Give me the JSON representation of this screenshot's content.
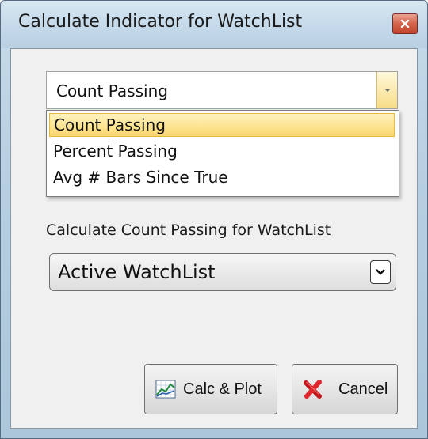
{
  "window": {
    "title": "Calculate Indicator for WatchList"
  },
  "indicator_select": {
    "value": "Count Passing",
    "options": [
      "Count Passing",
      "Percent Passing",
      "Avg # Bars Since True"
    ],
    "selected_index": 0
  },
  "watchlist": {
    "label": "Calculate Count Passing for WatchList",
    "value": "Active WatchList"
  },
  "buttons": {
    "calc_plot": "Calc & Plot",
    "cancel": "Cancel"
  },
  "icons": {
    "close": "close-icon",
    "calc_plot": "chart-icon",
    "cancel": "red-x-icon"
  },
  "colors": {
    "highlight": "#fbd86c",
    "title_bar": "#c3d8e9",
    "close_button": "#d4634b"
  }
}
